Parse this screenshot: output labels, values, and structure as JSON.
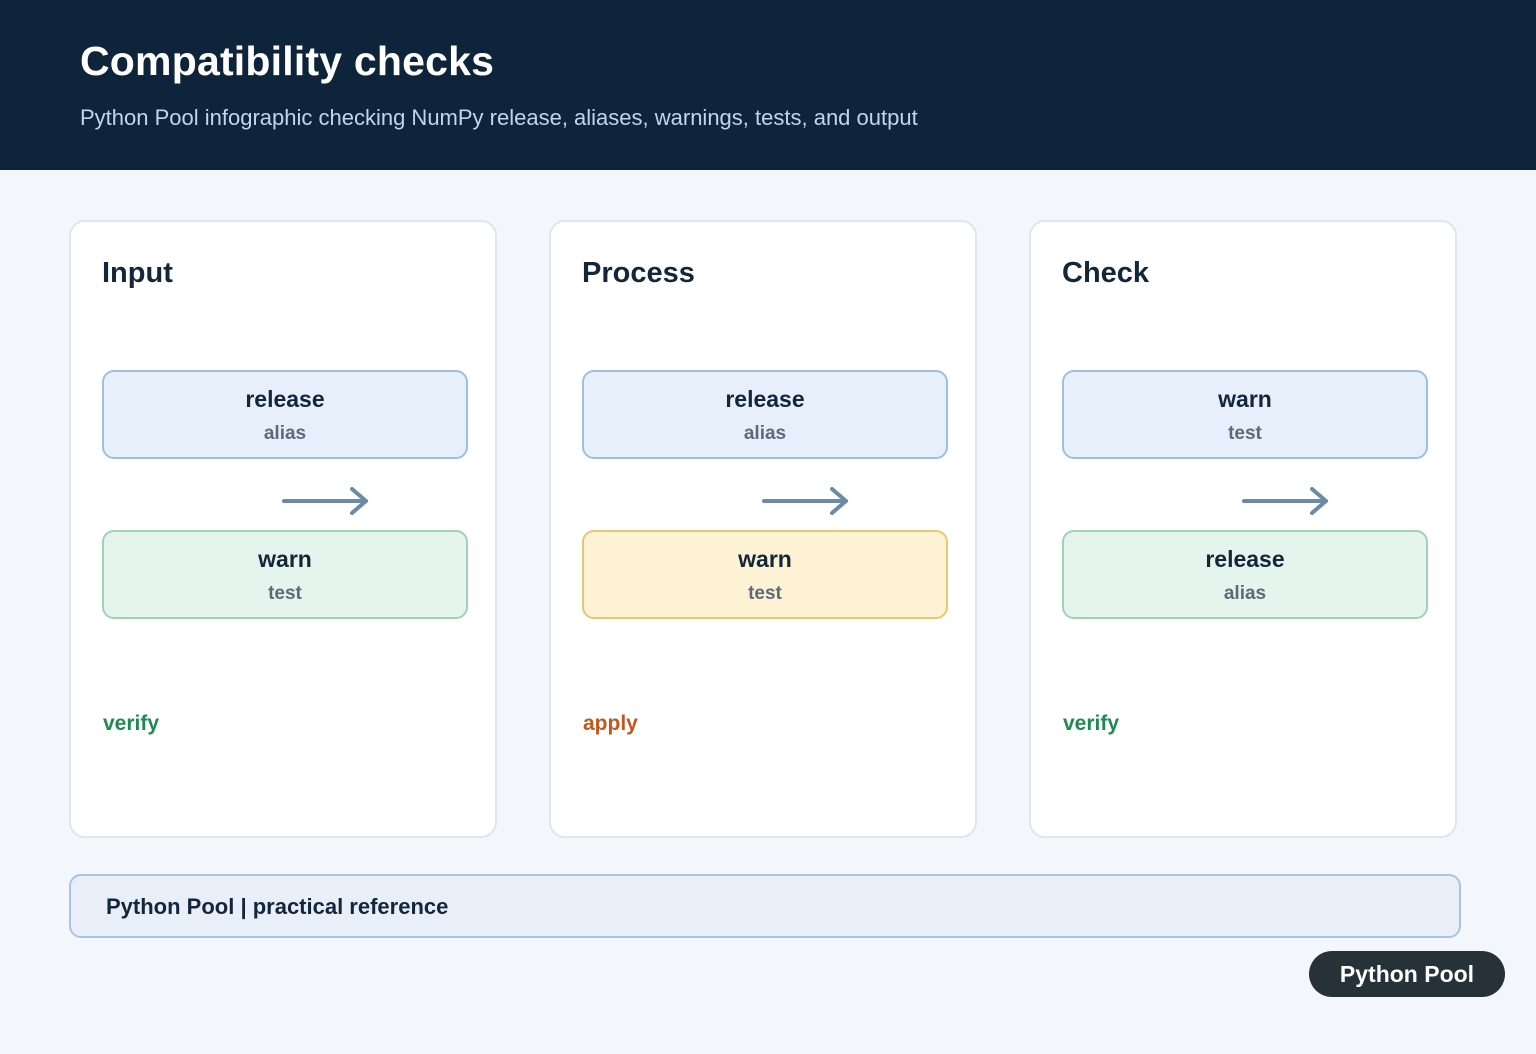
{
  "header": {
    "title": "Compatibility checks",
    "subtitle": "Python Pool infographic checking NumPy release, aliases, warnings, tests, and output"
  },
  "panels": [
    {
      "title": "Input",
      "top_node": {
        "main": "release",
        "sub": "alias",
        "tone": "blue"
      },
      "bottom_node": {
        "main": "warn",
        "sub": "test",
        "tone": "green"
      },
      "status": "verify",
      "status_color": "#1e8a52"
    },
    {
      "title": "Process",
      "top_node": {
        "main": "release",
        "sub": "alias",
        "tone": "blue"
      },
      "bottom_node": {
        "main": "warn",
        "sub": "test",
        "tone": "yellow"
      },
      "status": "apply",
      "status_color": "#c2561c"
    },
    {
      "title": "Check",
      "top_node": {
        "main": "warn",
        "sub": "test",
        "tone": "blue"
      },
      "bottom_node": {
        "main": "release",
        "sub": "alias",
        "tone": "green"
      },
      "status": "verify",
      "status_color": "#1e8a52"
    }
  ],
  "footer": {
    "text": "Python Pool | practical reference"
  },
  "badge": {
    "label": "Python Pool"
  },
  "colors": {
    "header_bg": "#0e243b",
    "arrow": "#6a8aa8",
    "node_blue": "#e7effa",
    "node_green": "#e5f5ed",
    "node_yellow": "#fef2d5"
  },
  "icons": {
    "flow_arrow": "arrow-right-icon"
  }
}
